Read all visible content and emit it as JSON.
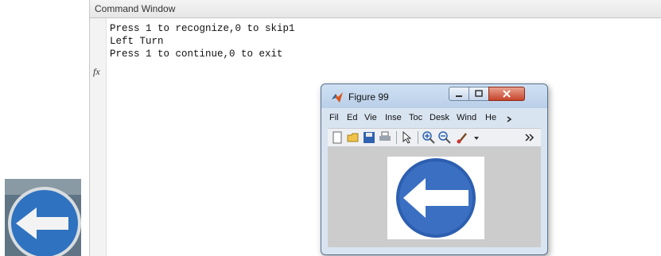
{
  "command_window": {
    "title": "Command Window",
    "prompt_symbol": "fx",
    "lines": [
      "Press 1 to recognize,0 to skip1",
      "Left Turn",
      "Press 1 to continue,0 to exit"
    ]
  },
  "figure_window": {
    "title": "Figure 99",
    "menu": [
      "Fil",
      "Ed",
      "Vie",
      "Inse",
      "Toc",
      "Desk",
      "Wind",
      "He"
    ],
    "toolbar_icons": [
      "new-file-icon",
      "open-folder-icon",
      "save-icon",
      "print-icon",
      "pointer-icon",
      "zoom-in-icon",
      "zoom-out-icon",
      "brush-icon",
      "dropdown-arrow-icon",
      "more-tools-icon"
    ],
    "content": "left-arrow traffic sign image"
  },
  "colors": {
    "sign_blue": "#3a6fc2",
    "sign_white": "#ffffff",
    "close_red": "#c7442b"
  }
}
